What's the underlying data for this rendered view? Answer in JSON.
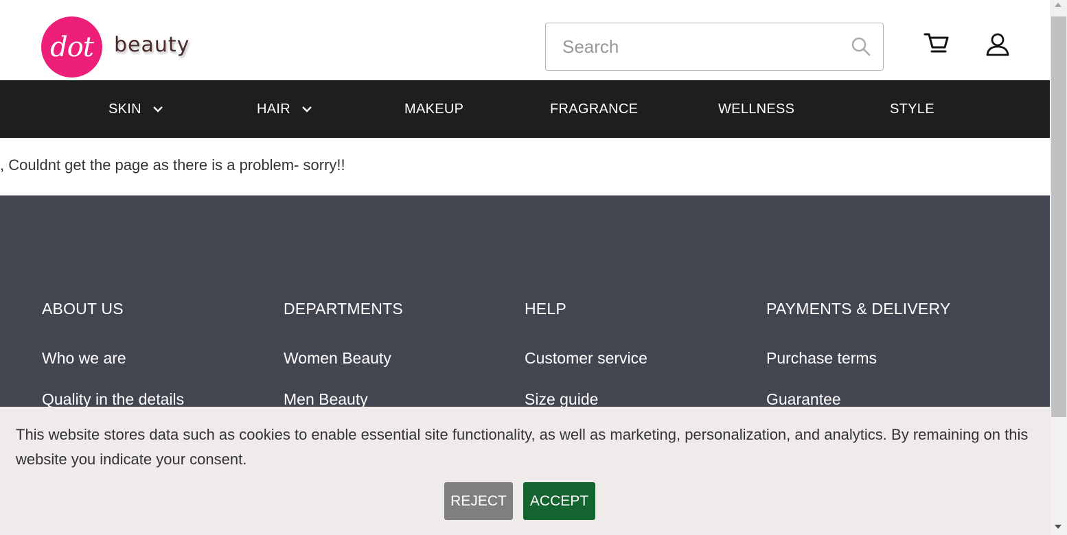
{
  "header": {
    "logo_mark": "dot",
    "logo_text": "beauty",
    "search_placeholder": "Search"
  },
  "nav": {
    "items": [
      {
        "label": "SKIN",
        "has_dropdown": true
      },
      {
        "label": "HAIR",
        "has_dropdown": true
      },
      {
        "label": "MAKEUP",
        "has_dropdown": false
      },
      {
        "label": "FRAGRANCE",
        "has_dropdown": false
      },
      {
        "label": "WELLNESS",
        "has_dropdown": false
      },
      {
        "label": "STYLE",
        "has_dropdown": false
      }
    ]
  },
  "main": {
    "message": ", Couldnt get the page as there is a problem- sorry!!"
  },
  "footer": {
    "columns": [
      {
        "heading": "ABOUT US",
        "links": [
          "Who we are",
          "Quality in the details"
        ]
      },
      {
        "heading": "DEPARTMENTS",
        "links": [
          "Women Beauty",
          "Men Beauty"
        ]
      },
      {
        "heading": "HELP",
        "links": [
          "Customer service",
          "Size guide"
        ]
      },
      {
        "heading": "PAYMENTS & DELIVERY",
        "links": [
          "Purchase terms",
          "Guarantee"
        ]
      }
    ]
  },
  "cookie": {
    "text": "This website stores data such as cookies to enable essential site functionality, as well as marketing, personalization, and analytics. By remaining on this website you indicate your consent.",
    "reject_label": "REJECT",
    "accept_label": "ACCEPT"
  },
  "icons": {
    "search": "search-icon",
    "cart": "cart-icon",
    "account": "user-icon",
    "dropdown": "chevron-down-icon"
  },
  "colors": {
    "brand_pink": "#ee1f78",
    "nav_bg": "#1e1e1e",
    "footer_bg": "#434650",
    "cookie_bg": "#efebea",
    "reject_bg": "#7f7f7f",
    "accept_bg": "#13642f"
  }
}
